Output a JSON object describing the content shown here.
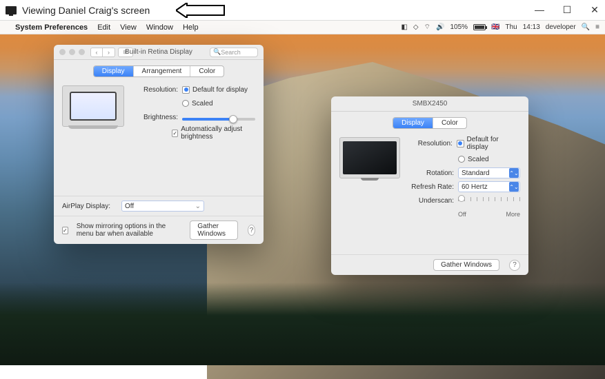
{
  "host_window": {
    "title": "Viewing Daniel Craig's screen",
    "controls": {
      "min": "—",
      "max": "☐",
      "close": "✕"
    }
  },
  "menubar": {
    "apple": "",
    "app": "System Preferences",
    "items": [
      "Edit",
      "View",
      "Window",
      "Help"
    ],
    "right": {
      "battery_pct": "105%",
      "flag": "🇬🇧",
      "day": "Thu",
      "time": "14:13",
      "user": "developer",
      "search": "🔍",
      "menu": "≡"
    }
  },
  "win1": {
    "title": "Built-in Retina Display",
    "search_placeholder": "Search",
    "tabs": [
      "Display",
      "Arrangement",
      "Color"
    ],
    "active_tab": 0,
    "resolution_label": "Resolution:",
    "res_default": "Default for display",
    "res_scaled": "Scaled",
    "brightness_label": "Brightness:",
    "brightness_pct": 70,
    "auto_bright": "Automatically adjust brightness",
    "airplay_label": "AirPlay Display:",
    "airplay_value": "Off",
    "mirror": "Show mirroring options in the menu bar when available",
    "gather": "Gather Windows"
  },
  "win2": {
    "title": "SMBX2450",
    "tabs": [
      "Display",
      "Color"
    ],
    "active_tab": 0,
    "resolution_label": "Resolution:",
    "res_default": "Default for display",
    "res_scaled": "Scaled",
    "rotation_label": "Rotation:",
    "rotation_value": "Standard",
    "refresh_label": "Refresh Rate:",
    "refresh_value": "60 Hertz",
    "underscan_label": "Underscan:",
    "underscan_off": "Off",
    "underscan_more": "More",
    "gather": "Gather Windows"
  }
}
